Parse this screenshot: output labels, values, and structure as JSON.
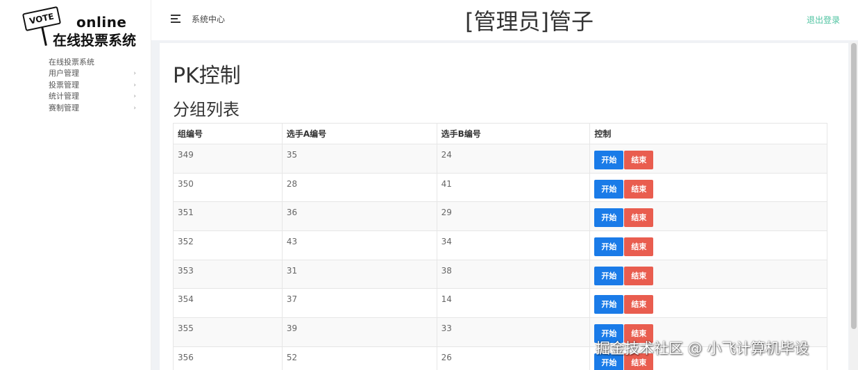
{
  "logo": {
    "sign": "VOTE",
    "en": "online",
    "cn": "在线投票系统"
  },
  "sidebar": {
    "title": "在线投票系统",
    "items": [
      {
        "label": "用户管理"
      },
      {
        "label": "投票管理"
      },
      {
        "label": "统计管理"
      },
      {
        "label": "赛制管理"
      }
    ]
  },
  "header": {
    "system_center": "系统中心",
    "admin_title": "[管理员]管子",
    "logout": "退出登录"
  },
  "main": {
    "page_title": "PK控制",
    "section_title": "分组列表",
    "table": {
      "headers": [
        "组编号",
        "选手A编号",
        "选手B编号",
        "控制"
      ],
      "rows": [
        {
          "group": "349",
          "a": "35",
          "b": "24"
        },
        {
          "group": "350",
          "a": "28",
          "b": "41"
        },
        {
          "group": "351",
          "a": "36",
          "b": "29"
        },
        {
          "group": "352",
          "a": "43",
          "b": "34"
        },
        {
          "group": "353",
          "a": "31",
          "b": "38"
        },
        {
          "group": "354",
          "a": "37",
          "b": "14"
        },
        {
          "group": "355",
          "a": "39",
          "b": "33"
        },
        {
          "group": "356",
          "a": "52",
          "b": "26"
        }
      ],
      "start_label": "开始",
      "end_label": "结束"
    }
  },
  "watermark": "掘金技术社区 @ 小飞计算机毕设",
  "colors": {
    "start_button": "#1a7be8",
    "end_button": "#e95d4f",
    "logout_link": "#4fc3a1"
  }
}
